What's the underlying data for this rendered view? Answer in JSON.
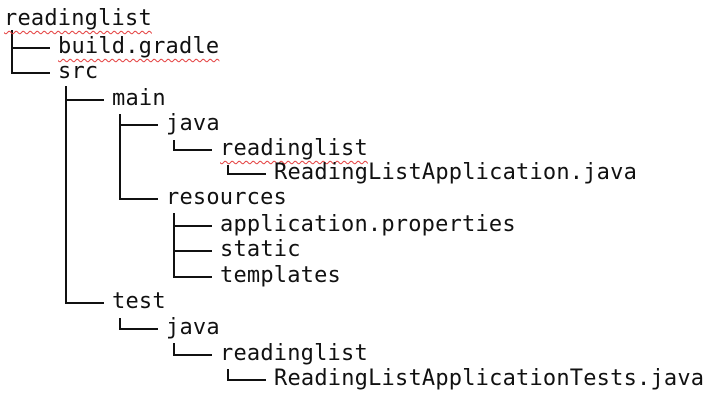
{
  "tree": {
    "root": "readinglist",
    "nodes": [
      {
        "id": "build-gradle",
        "label": "build.gradle",
        "depth": 1,
        "spell_underline": true
      },
      {
        "id": "src",
        "label": "src",
        "depth": 1
      },
      {
        "id": "main",
        "label": "main",
        "depth": 2
      },
      {
        "id": "main-java",
        "label": "java",
        "depth": 3
      },
      {
        "id": "main-readinglist",
        "label": "readinglist",
        "depth": 4,
        "spell_underline": true
      },
      {
        "id": "app-java",
        "label": "ReadingListApplication.java",
        "depth": 5
      },
      {
        "id": "resources",
        "label": "resources",
        "depth": 3
      },
      {
        "id": "app-properties",
        "label": "application.properties",
        "depth": 4
      },
      {
        "id": "static",
        "label": "static",
        "depth": 4
      },
      {
        "id": "templates",
        "label": "templates",
        "depth": 4
      },
      {
        "id": "test",
        "label": "test",
        "depth": 2
      },
      {
        "id": "test-java",
        "label": "java",
        "depth": 3
      },
      {
        "id": "test-readinglist",
        "label": "readinglist",
        "depth": 4
      },
      {
        "id": "app-tests-java",
        "label": "ReadingListApplicationTests.java",
        "depth": 5
      }
    ],
    "colors": {
      "text": "#111111",
      "spellcheck_underline": "#e33b3b",
      "background": "#ffffff"
    }
  }
}
